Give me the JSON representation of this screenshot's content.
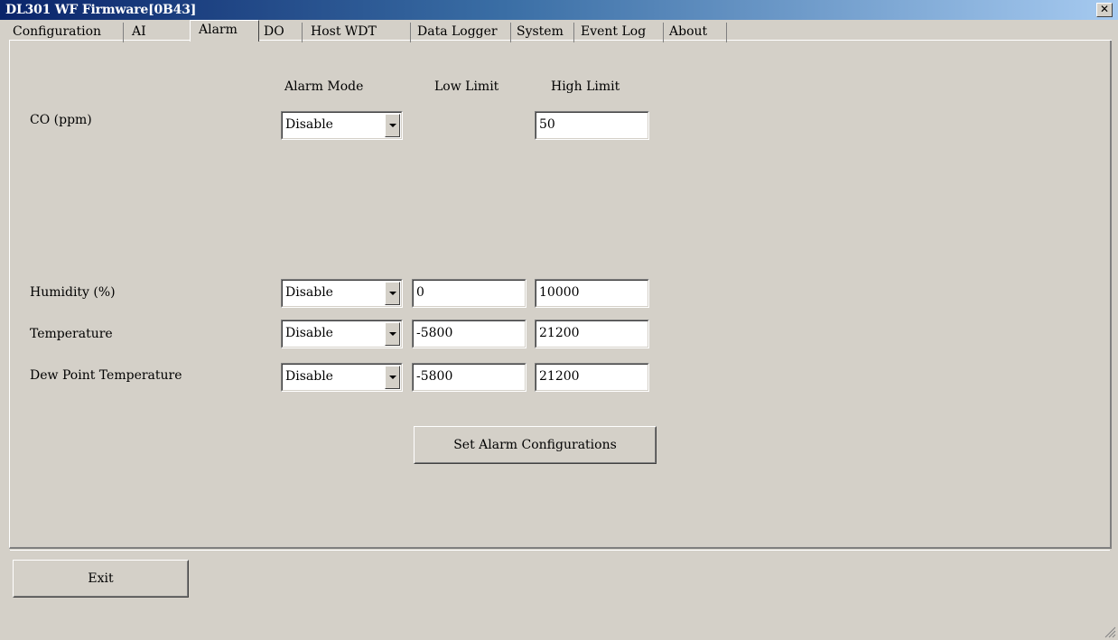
{
  "window": {
    "title": "DL301 WF Firmware[0B43]"
  },
  "tabs": [
    "Configuration",
    "AI",
    "Alarm",
    "DO",
    "Host WDT",
    "Data Logger",
    "System",
    "Event Log",
    "About"
  ],
  "columns": {
    "mode": "Alarm Mode",
    "low": "Low Limit",
    "high": "High Limit"
  },
  "rows": [
    {
      "label": "CO (ppm)",
      "mode": "Disable",
      "low": null,
      "high": "50"
    },
    {
      "label": "Humidity (%)",
      "mode": "Disable",
      "low": "0",
      "high": "10000"
    },
    {
      "label": "Temperature",
      "mode": "Disable",
      "low": "-5800",
      "high": "21200"
    },
    {
      "label": "Dew Point Temperature",
      "mode": "Disable",
      "low": "-5800",
      "high": "21200"
    }
  ],
  "buttons": {
    "set_alarm": "Set Alarm Configurations",
    "exit": "Exit"
  },
  "icons": {
    "close": "close-icon",
    "dropdown": "chevron-down-icon",
    "resize": "resize-grip-icon"
  }
}
